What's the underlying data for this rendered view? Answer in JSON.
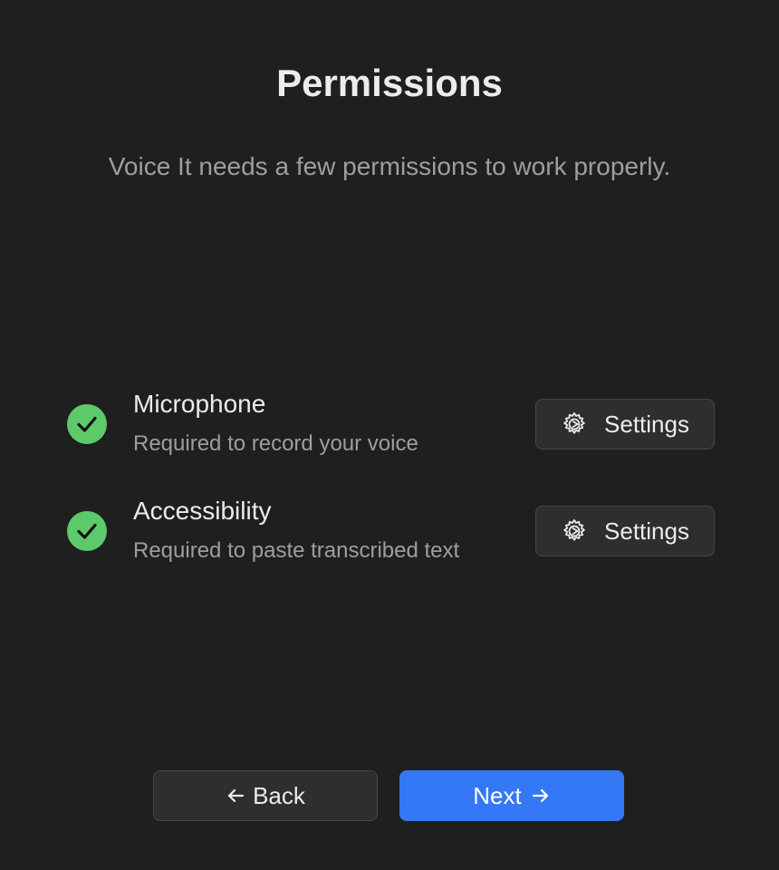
{
  "header": {
    "title": "Permissions",
    "subtitle": "Voice It needs a few permissions to work properly."
  },
  "permissions": [
    {
      "title": "Microphone",
      "description": "Required to record your voice",
      "granted": true,
      "status_icon": "checkmark-circle-icon",
      "button_label": "Settings",
      "button_icon": "gear-icon"
    },
    {
      "title": "Accessibility",
      "description": "Required to paste transcribed text",
      "granted": true,
      "status_icon": "checkmark-circle-icon",
      "button_label": "Settings",
      "button_icon": "gear-icon"
    }
  ],
  "footer": {
    "back_label": "Back",
    "back_icon": "arrow-left-icon",
    "next_label": "Next",
    "next_icon": "arrow-right-icon"
  },
  "colors": {
    "background": "#1f1f1f",
    "granted": "#5dc96b",
    "accent": "#3478f6",
    "secondary_button": "#2e2e2e"
  }
}
